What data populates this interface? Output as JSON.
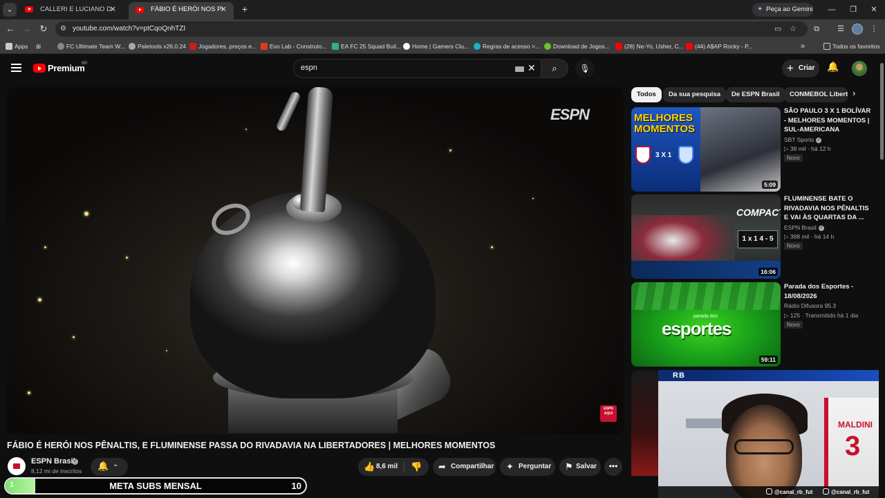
{
  "browser": {
    "tabs": [
      {
        "label": "CALLERI E LUCIANO DECIDEM..."
      },
      {
        "label": "FÁBIO É HERÓI NOS PÊNALTIS..."
      }
    ],
    "gemini_label": "Peça ao Gemini",
    "url": "youtube.com/watch?v=ptCqoQnhTZI",
    "bookmarks": [
      {
        "label": "Apps",
        "color": "#cccccc"
      },
      {
        "label": "FC Ultimate Team W...",
        "color": "#888888"
      },
      {
        "label": "Paletools v26.0.24",
        "color": "#aaaaaa"
      },
      {
        "label": "Jogadores, preços e...",
        "color": "#c81e1e"
      },
      {
        "label": "Evo Lab - Construto...",
        "color": "#e03a1a"
      },
      {
        "label": "EA FC 25 Squad Buil...",
        "color": "#2db38a"
      },
      {
        "label": "Home | Gamers Clu...",
        "color": "#ffffff"
      },
      {
        "label": "Regras de acesso >...",
        "color": "#17b3c8"
      },
      {
        "label": "Download de Jogos...",
        "color": "#6dbf2c"
      },
      {
        "label": "(28) Ne-Yo, Usher, C...",
        "color": "#ff0000"
      },
      {
        "label": "(44) A$AP Rocky - P...",
        "color": "#ff0000"
      }
    ],
    "all_favorites_label": "Todos os favoritos"
  },
  "header": {
    "brand": "Premium",
    "region": "BR",
    "search_value": "espn",
    "create_label": "Criar"
  },
  "video": {
    "watermark": "ESPN",
    "corner_badge": "ESPN AQUI",
    "title": "FÁBIO É HERÓI NOS PÊNALTIS, E FLUMINENSE PASSA DO RIVADAVIA NA LIBERTADORES | MELHORES MOMENTOS",
    "channel": "ESPN Brasil",
    "subscribers": "8,12 mi de inscritos",
    "likes": "8,6 mil",
    "share_label": "Compartilhar",
    "ask_label": "Perguntar",
    "save_label": "Salvar"
  },
  "overlay": {
    "meta_label": "META SUBS MENSAL",
    "meta_current": "1",
    "meta_goal": "10",
    "meta_progress": 0.1
  },
  "chips": [
    "Todos",
    "Da sua pesquisa",
    "De ESPN Brasil",
    "CONMEBOL Liberta"
  ],
  "recommendations": [
    {
      "title": "SÃO PAULO 3 X 1 BOLÍVAR - MELHORES MOMENTOS | SUL-AMERICANA",
      "channel": "SBT Sports",
      "verified": true,
      "views": "38 mil",
      "age": "há 12 h",
      "badge": "Novo",
      "duration": "5:09",
      "thumb_text": "MELHORES MOMENTOS",
      "thumb_score": "3 X 1"
    },
    {
      "title": "FLUMINENSE BATE O RIVADAVIA NOS PÊNALTIS E VAI ÀS QUARTAS DA ...",
      "channel": "ESPN Brasil",
      "verified": true,
      "views": "398 mil",
      "age": "há 14 h",
      "badge": "Novo",
      "duration": "16:06",
      "thumb_text": "COMPACTO",
      "thumb_score": "1 x 1  4 - 5"
    },
    {
      "title": "Parada dos Esportes - 18/08/2026",
      "channel": "Rádio Difusora 95.3",
      "verified": false,
      "views": "125",
      "age": "Transmitido há 1 dia",
      "badge": "Novo",
      "duration": "59:11",
      "thumb_small": "parada dos",
      "thumb_big": "esportes"
    }
  ],
  "webcam": {
    "tag": "RB",
    "shirt_name": "MALDINI",
    "shirt_number": "3",
    "handle_instagram": "@canal_rb_fut",
    "handle_tiktok": "@canal_rb_fut"
  }
}
